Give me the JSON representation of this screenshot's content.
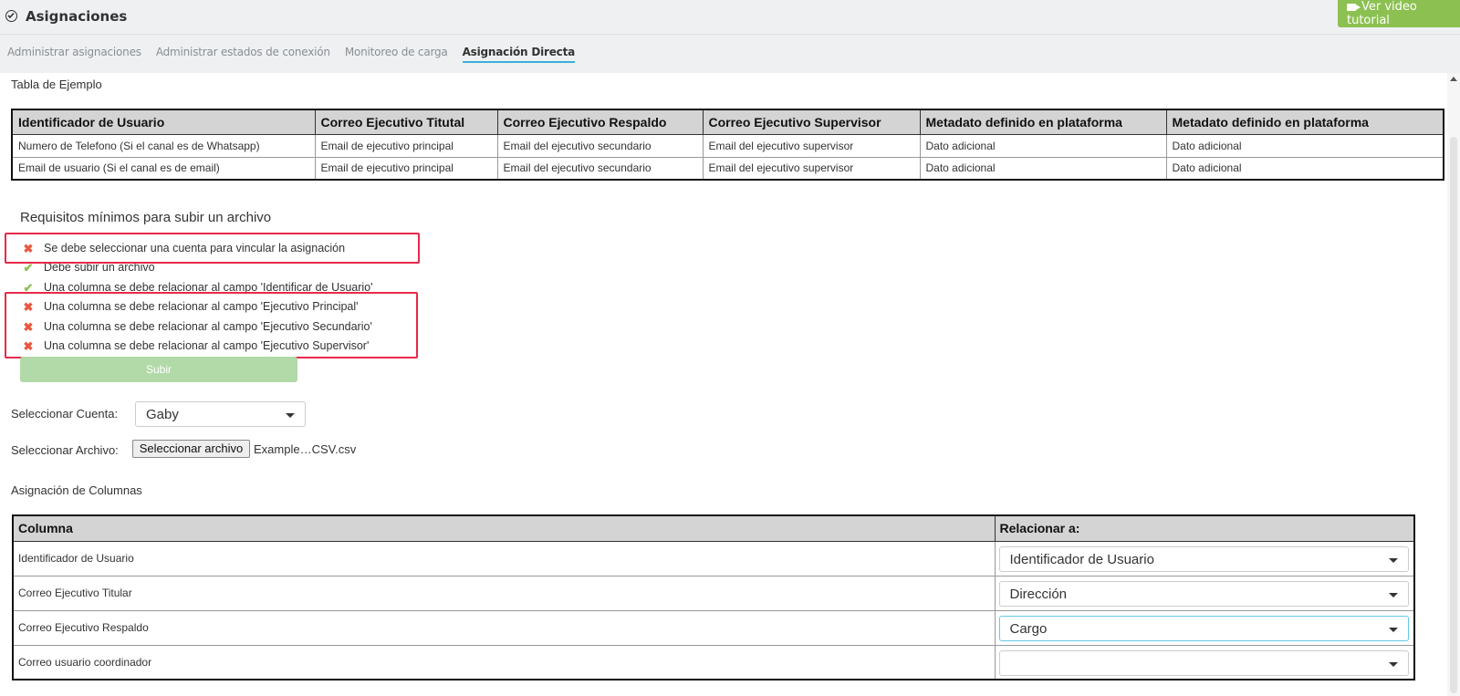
{
  "header": {
    "title": "Asignaciones",
    "tutorial_button": "Ver video tutorial"
  },
  "tabs": [
    {
      "label": "Administrar asignaciones"
    },
    {
      "label": "Administrar estados de conexión"
    },
    {
      "label": "Monitoreo de carga"
    },
    {
      "label": "Asignación Directa"
    }
  ],
  "example": {
    "title": "Tabla de Ejemplo",
    "headers": [
      "Identificador de Usuario",
      "Correo Ejecutivo Titutal",
      "Correo Ejecutivo Respaldo",
      "Correo Ejecutivo Supervisor",
      "Metadato definido en plataforma",
      "Metadato definido en plataforma"
    ],
    "rows": [
      [
        "Numero de Telefono (Si el canal es de Whatsapp)",
        "Email de ejecutivo principal",
        "Email del ejecutivo secundario",
        "Email del ejecutivo supervisor",
        "Dato adicional",
        "Dato adicional"
      ],
      [
        "Email de usuario (Si el canal es de email)",
        "Email de ejecutivo principal",
        "Email del ejecutivo secundario",
        "Email del ejecutivo supervisor",
        "Dato adicional",
        "Dato adicional"
      ]
    ]
  },
  "requirements": {
    "title": "Requisitos mínimos para subir un archivo",
    "items": [
      {
        "text": "Se debe seleccionar una cuenta para vincular la asignación",
        "status": "fail",
        "mark": "✖"
      },
      {
        "text": "Debe subir un archivo",
        "status": "ok",
        "mark": "✔"
      },
      {
        "text": "Una columna se debe relacionar al campo 'Identificar de Usuario'",
        "status": "ok",
        "mark": "✔"
      },
      {
        "text": "Una columna se debe relacionar al campo 'Ejecutivo Principal'",
        "status": "fail",
        "mark": "✖"
      },
      {
        "text": "Una columna se debe relacionar al campo 'Ejecutivo Secundario'",
        "status": "fail",
        "mark": "✖"
      },
      {
        "text": "Una columna se debe relacionar al campo 'Ejecutivo Supervisor'",
        "status": "fail",
        "mark": "✖"
      }
    ],
    "upload_button": "Subir"
  },
  "form": {
    "account_label": "Seleccionar Cuenta:",
    "account_value": "Gaby",
    "file_label": "Seleccionar Archivo:",
    "file_button": "Seleccionar archivo",
    "file_name": "Example…CSV.csv"
  },
  "mapping": {
    "title": "Asignación de Columnas",
    "headers": [
      "Columna",
      "Relacionar a:"
    ],
    "rows": [
      {
        "column": "Identificador de Usuario",
        "relate": "Identificador de Usuario"
      },
      {
        "column": "Correo Ejecutivo Titular",
        "relate": "Dirección"
      },
      {
        "column": "Correo Ejecutivo Respaldo",
        "relate": "Cargo"
      },
      {
        "column": "Correo usuario coordinador",
        "relate": ""
      }
    ]
  },
  "colors": {
    "accent_green": "#8cc152",
    "fail_red": "#e9573f",
    "highlight_red": "#e8294a",
    "active_tab_underline": "#3bafda"
  }
}
